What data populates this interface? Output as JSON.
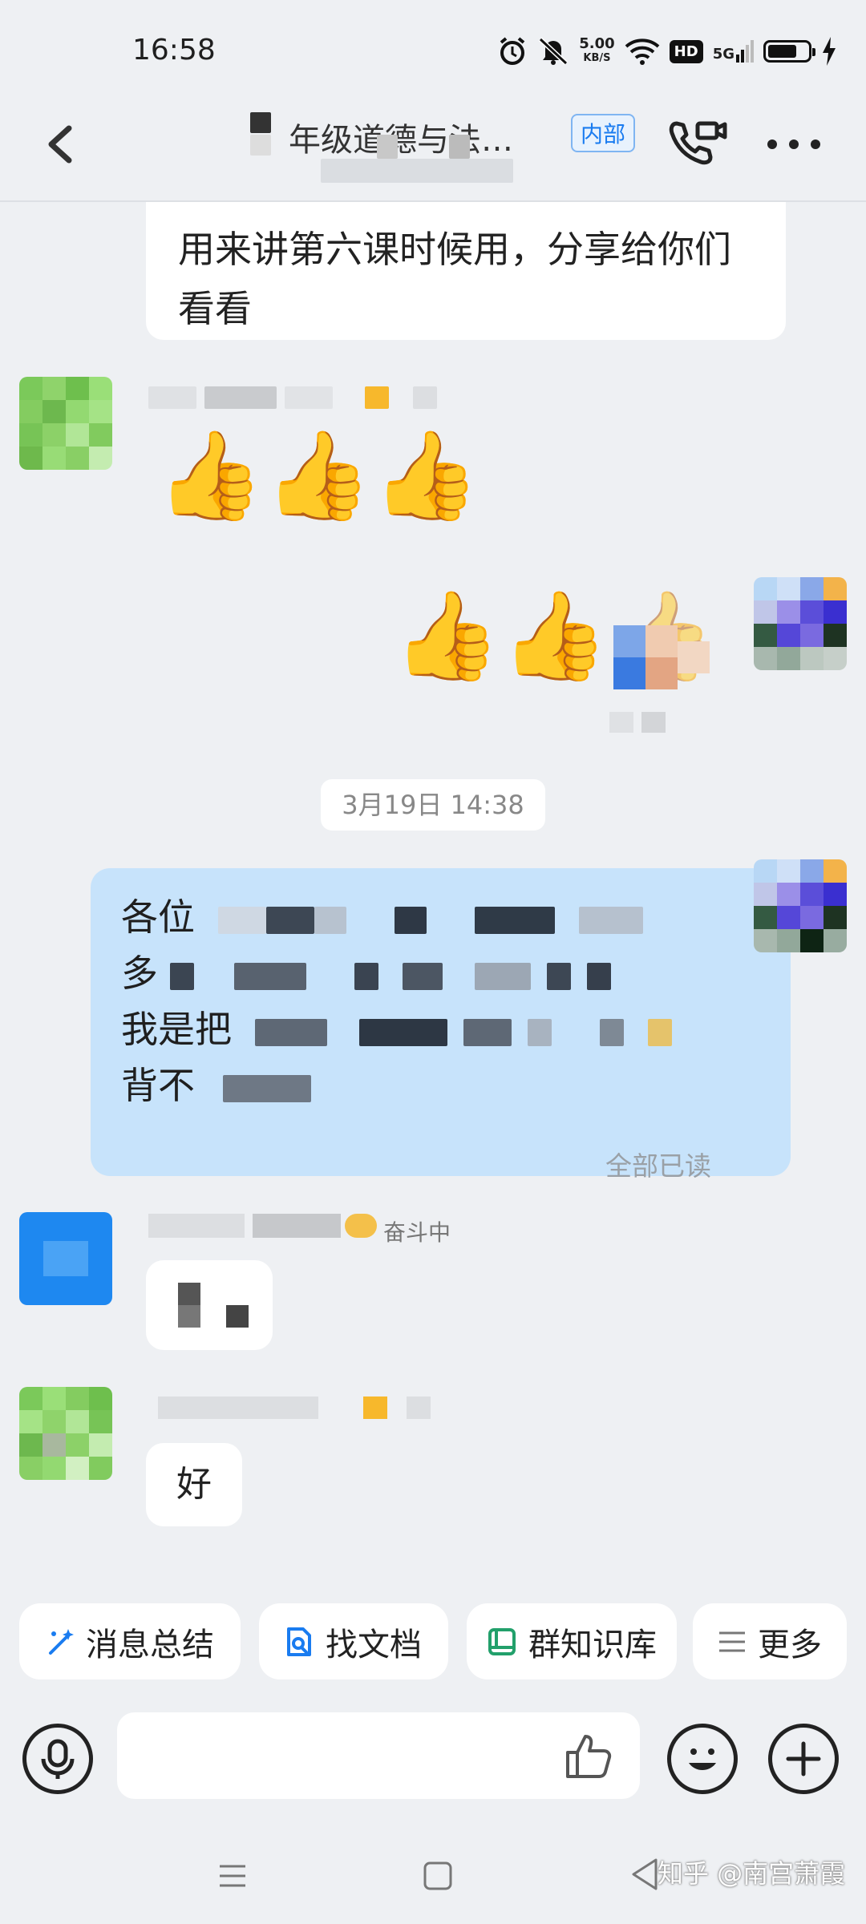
{
  "status_bar": {
    "time": "16:58",
    "net_speed_value": "5.00",
    "net_speed_unit": "KB/S",
    "hd_label": "HD",
    "signal_label": "5G",
    "battery_level": 0.72
  },
  "header": {
    "title": "年级道德与法…",
    "badge": "内部"
  },
  "messages": {
    "msg1_text": "用来讲第六课时候用，分享给你们看看",
    "msg1_line1": "用来讲第六课时候用，分享给你们",
    "msg1_line2": "看看",
    "timestamp": "3月19日 14:38",
    "sent_lines": [
      "各位",
      "多",
      "我是把",
      "背不"
    ],
    "read_status": "全部已读",
    "status_tag": "奋斗中",
    "reply_2": "好"
  },
  "quick_actions": {
    "summary": "消息总结",
    "find_doc": "找文档",
    "knowledge": "群知识库",
    "more": "更多"
  },
  "watermark": "知乎 @南宫萧霞",
  "icons": [
    "back-icon",
    "video-call-icon",
    "more-icon",
    "sparkle-icon",
    "doc-search-icon",
    "book-icon",
    "menu-icon",
    "mic-icon",
    "thumbs-up-icon",
    "emoji-icon",
    "plus-icon",
    "nav-menu-icon",
    "nav-home-icon",
    "nav-back-icon",
    "alarm-icon",
    "mute-icon",
    "wifi-icon"
  ],
  "colors": {
    "accent": "#1a7cf0",
    "sent_bubble": "#c7e3fb",
    "background": "#eef0f3"
  }
}
